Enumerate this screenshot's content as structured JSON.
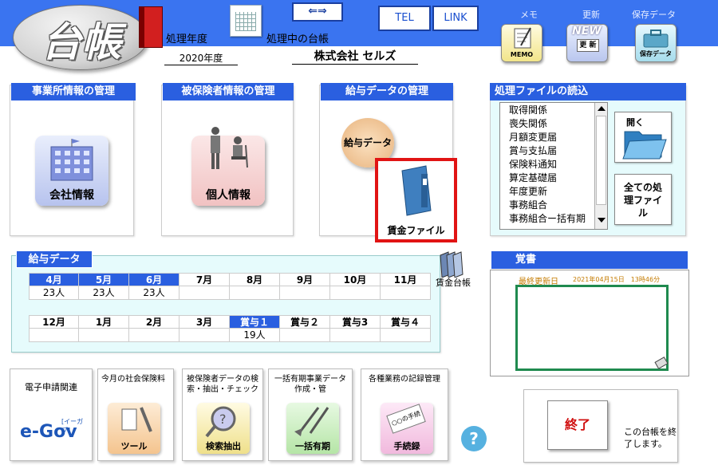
{
  "app": {
    "logo": "台帳",
    "year_label": "処理年度",
    "year_value": "2020年度",
    "current_label": "処理中の台帳",
    "company": "株式会社 セルズ"
  },
  "toolbar": {
    "arrow": "⇐⇒",
    "tel": "TEL",
    "link": "LINK",
    "memo_label": "メモ",
    "memo_sub": "MEMO",
    "update_label": "更新",
    "update_badge": "NEW",
    "update_sub": "更 新",
    "save_label": "保存データ",
    "save_sub": "保存データ"
  },
  "panels": {
    "office": {
      "title": "事業所情報の管理",
      "button": "会社情報"
    },
    "insured": {
      "title": "被保険者情報の管理",
      "button": "個人情報"
    },
    "salary": {
      "title": "給与データの管理",
      "button": "給与データ",
      "wage_file": "賃金ファイル"
    }
  },
  "files": {
    "title": "処理ファイルの読込",
    "items": [
      "取得関係",
      "喪失関係",
      "月額変更届",
      "賞与支払届",
      "保険料通知",
      "算定基礎届",
      "年度更新",
      "事務組合",
      "事務組合ー括有期"
    ],
    "open_button": "開く",
    "all_button": "全ての処理ファイル"
  },
  "salary_data": {
    "title": "給与データ",
    "ledger_label": "賃金台帳",
    "row1": [
      {
        "label": "4月",
        "value": "23人",
        "active": true
      },
      {
        "label": "5月",
        "value": "23人",
        "active": true
      },
      {
        "label": "6月",
        "value": "23人",
        "active": true
      },
      {
        "label": "7月",
        "value": "",
        "active": false
      },
      {
        "label": "8月",
        "value": "",
        "active": false
      },
      {
        "label": "9月",
        "value": "",
        "active": false
      },
      {
        "label": "10月",
        "value": "",
        "active": false
      },
      {
        "label": "11月",
        "value": "",
        "active": false
      }
    ],
    "row2": [
      {
        "label": "12月",
        "value": "",
        "active": false
      },
      {
        "label": "1月",
        "value": "",
        "active": false
      },
      {
        "label": "2月",
        "value": "",
        "active": false
      },
      {
        "label": "3月",
        "value": "",
        "active": false
      },
      {
        "label": "賞与１",
        "value": "19人",
        "active": true
      },
      {
        "label": "賞与２",
        "value": "",
        "active": false
      },
      {
        "label": "賞与3",
        "value": "",
        "active": false
      },
      {
        "label": "賞与４",
        "value": "",
        "active": false
      }
    ]
  },
  "notes": {
    "title": "覚書",
    "updated_label": "最終更新日",
    "updated_value": "2021年04月15日　13時46分"
  },
  "tools": [
    {
      "title": "電子申請関連",
      "icon": "e-Gov",
      "icon_sub": "[イーガブ]"
    },
    {
      "title": "今月の社会保険料",
      "icon": "ツール"
    },
    {
      "title": "被保険者データの検索・抽出・チェック",
      "icon": "検索抽出"
    },
    {
      "title": "一括有期事業データ作成・管",
      "icon": "一括有期"
    },
    {
      "title": "各種業務の記録管理",
      "icon": "手続録",
      "icon_top": "○○の手続"
    }
  ],
  "exit": {
    "button": "終了",
    "note": "この台帳を終了します。"
  },
  "help_icon": "?"
}
